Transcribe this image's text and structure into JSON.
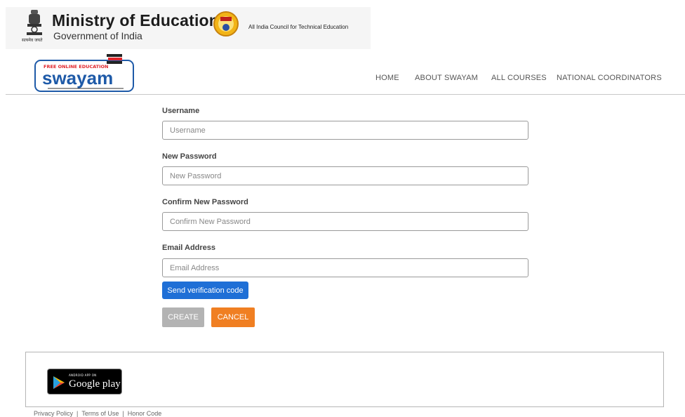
{
  "header": {
    "ministry_title": "Ministry of Education",
    "ministry_subtitle": "Government of India",
    "emblem_caption": "सत्यमेव जयते",
    "aicte_text": "All India Council for Technical Education"
  },
  "nav": {
    "items": [
      "HOME",
      "ABOUT SWAYAM",
      "ALL COURSES",
      "NATIONAL COORDINATORS"
    ]
  },
  "logo": {
    "tagline": "FREE ONLINE EDUCATION",
    "name": "swayam"
  },
  "form": {
    "username": {
      "label": "Username",
      "placeholder": "Username",
      "value": ""
    },
    "new_password": {
      "label": "New Password",
      "placeholder": "New Password",
      "value": ""
    },
    "confirm_password": {
      "label": "Confirm New Password",
      "placeholder": "Confirm New Password",
      "value": ""
    },
    "email": {
      "label": "Email Address",
      "placeholder": "Email Address",
      "value": ""
    },
    "send_code_label": "Send verification code",
    "create_label": "CREATE",
    "cancel_label": "CANCEL"
  },
  "footer": {
    "badge_small": "ANDROID APP ON",
    "badge_text": "Google play",
    "links": [
      "Privacy Policy",
      "Terms of Use",
      "Honor Code"
    ]
  },
  "colors": {
    "verify_button": "#1f6fd6",
    "create_button": "#b3b3b3",
    "cancel_button": "#f07f22",
    "logo_blue": "#1e5aa8",
    "logo_red": "#e0252b"
  }
}
